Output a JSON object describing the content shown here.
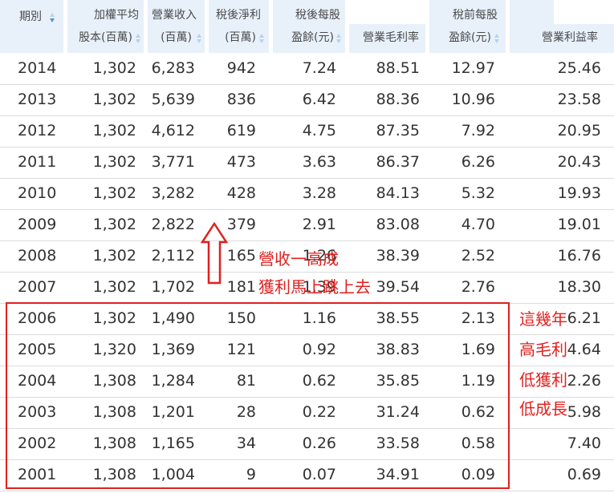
{
  "headers": [
    {
      "line1": "期別",
      "line2": "",
      "sort": "on"
    },
    {
      "line1": "加權平均",
      "line2": "股本(百萬)",
      "sort": "off"
    },
    {
      "line1": "營業收入",
      "line2": "(百萬)",
      "sort": "off"
    },
    {
      "line1": "稅後淨利",
      "line2": "(百萬)",
      "sort": "off"
    },
    {
      "line1": "稅後每股",
      "line2": "盈餘(元)",
      "sort": "off"
    },
    {
      "line1": "",
      "line2": "營業毛利率",
      "sort": "off"
    },
    {
      "line1": "稅前每股",
      "line2": "盈餘(元)",
      "sort": "off"
    },
    {
      "line1": "",
      "line2": "營業利益率",
      "sort": "off"
    }
  ],
  "rows": [
    [
      "2014",
      "1,302",
      "6,283",
      "942",
      "7.24",
      "88.51",
      "12.97",
      "25.46"
    ],
    [
      "2013",
      "1,302",
      "5,639",
      "836",
      "6.42",
      "88.36",
      "10.96",
      "23.58"
    ],
    [
      "2012",
      "1,302",
      "4,612",
      "619",
      "4.75",
      "87.35",
      "7.92",
      "20.95"
    ],
    [
      "2011",
      "1,302",
      "3,771",
      "473",
      "3.63",
      "86.37",
      "6.26",
      "20.43"
    ],
    [
      "2010",
      "1,302",
      "3,282",
      "428",
      "3.28",
      "84.13",
      "5.32",
      "19.93"
    ],
    [
      "2009",
      "1,302",
      "2,822",
      "379",
      "2.91",
      "83.08",
      "4.70",
      "19.01"
    ],
    [
      "2008",
      "1,302",
      "2,112",
      "165",
      "1.26",
      "38.39",
      "2.52",
      "16.76"
    ],
    [
      "2007",
      "1,302",
      "1,702",
      "181",
      "1.39",
      "39.54",
      "2.76",
      "18.30"
    ],
    [
      "2006",
      "1,302",
      "1,490",
      "150",
      "1.16",
      "38.55",
      "2.13",
      "16.21"
    ],
    [
      "2005",
      "1,320",
      "1,369",
      "121",
      "0.92",
      "38.83",
      "1.69",
      "14.64"
    ],
    [
      "2004",
      "1,308",
      "1,284",
      "81",
      "0.62",
      "35.85",
      "1.19",
      "12.26"
    ],
    [
      "2003",
      "1,308",
      "1,201",
      "28",
      "0.22",
      "31.24",
      "0.62",
      "5.98"
    ],
    [
      "2002",
      "1,308",
      "1,165",
      "34",
      "0.26",
      "33.58",
      "0.58",
      "7.40"
    ],
    [
      "2001",
      "1,308",
      "1,004",
      "9",
      "0.07",
      "34.91",
      "0.09",
      "0.69"
    ]
  ],
  "annotations": {
    "arrow_note_1": "營收一高成",
    "arrow_note_2": "獲利馬上跳上去",
    "box_note_1": "這幾年",
    "box_note_2": "高毛利",
    "box_note_3": "低獲利",
    "box_note_4": "低成長"
  },
  "colors": {
    "header_bg": "#e8f1fa",
    "sort_arrow": "#b8d2ea",
    "annotation_red": "#e0201e",
    "row_border": "#dcdcdc"
  }
}
